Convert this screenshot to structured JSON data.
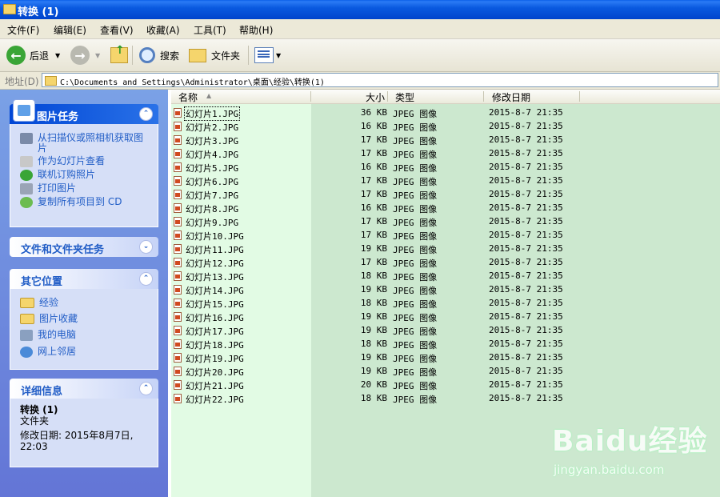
{
  "window": {
    "title": "转换 (1)"
  },
  "menu": [
    "文件(F)",
    "编辑(E)",
    "查看(V)",
    "收藏(A)",
    "工具(T)",
    "帮助(H)"
  ],
  "toolbar": {
    "back_label": "后退",
    "search_label": "搜索",
    "folders_label": "文件夹"
  },
  "address": {
    "label": "地址(D)",
    "path": "C:\\Documents and Settings\\Administrator\\桌面\\经验\\转换(1)"
  },
  "taskpane": {
    "picture_tasks": {
      "title": "图片任务",
      "items": [
        "从扫描仪或照相机获取图片",
        "作为幻灯片查看",
        "联机订购照片",
        "打印图片",
        "复制所有项目到 CD"
      ]
    },
    "file_tasks": {
      "title": "文件和文件夹任务"
    },
    "other_places": {
      "title": "其它位置",
      "items": [
        "经验",
        "图片收藏",
        "我的电脑",
        "网上邻居"
      ]
    },
    "details": {
      "title": "详细信息",
      "name": "转换 (1)",
      "type": "文件夹",
      "modified": "修改日期: 2015年8月7日, 22:03"
    }
  },
  "columns": {
    "name": "名称",
    "size": "大小",
    "type": "类型",
    "date": "修改日期"
  },
  "files": [
    {
      "name": "幻灯片1.JPG",
      "size": "36 KB",
      "type": "JPEG 图像",
      "date": "2015-8-7 21:35"
    },
    {
      "name": "幻灯片2.JPG",
      "size": "16 KB",
      "type": "JPEG 图像",
      "date": "2015-8-7 21:35"
    },
    {
      "name": "幻灯片3.JPG",
      "size": "17 KB",
      "type": "JPEG 图像",
      "date": "2015-8-7 21:35"
    },
    {
      "name": "幻灯片4.JPG",
      "size": "17 KB",
      "type": "JPEG 图像",
      "date": "2015-8-7 21:35"
    },
    {
      "name": "幻灯片5.JPG",
      "size": "16 KB",
      "type": "JPEG 图像",
      "date": "2015-8-7 21:35"
    },
    {
      "name": "幻灯片6.JPG",
      "size": "17 KB",
      "type": "JPEG 图像",
      "date": "2015-8-7 21:35"
    },
    {
      "name": "幻灯片7.JPG",
      "size": "17 KB",
      "type": "JPEG 图像",
      "date": "2015-8-7 21:35"
    },
    {
      "name": "幻灯片8.JPG",
      "size": "16 KB",
      "type": "JPEG 图像",
      "date": "2015-8-7 21:35"
    },
    {
      "name": "幻灯片9.JPG",
      "size": "17 KB",
      "type": "JPEG 图像",
      "date": "2015-8-7 21:35"
    },
    {
      "name": "幻灯片10.JPG",
      "size": "17 KB",
      "type": "JPEG 图像",
      "date": "2015-8-7 21:35"
    },
    {
      "name": "幻灯片11.JPG",
      "size": "19 KB",
      "type": "JPEG 图像",
      "date": "2015-8-7 21:35"
    },
    {
      "name": "幻灯片12.JPG",
      "size": "17 KB",
      "type": "JPEG 图像",
      "date": "2015-8-7 21:35"
    },
    {
      "name": "幻灯片13.JPG",
      "size": "18 KB",
      "type": "JPEG 图像",
      "date": "2015-8-7 21:35"
    },
    {
      "name": "幻灯片14.JPG",
      "size": "19 KB",
      "type": "JPEG 图像",
      "date": "2015-8-7 21:35"
    },
    {
      "name": "幻灯片15.JPG",
      "size": "18 KB",
      "type": "JPEG 图像",
      "date": "2015-8-7 21:35"
    },
    {
      "name": "幻灯片16.JPG",
      "size": "19 KB",
      "type": "JPEG 图像",
      "date": "2015-8-7 21:35"
    },
    {
      "name": "幻灯片17.JPG",
      "size": "19 KB",
      "type": "JPEG 图像",
      "date": "2015-8-7 21:35"
    },
    {
      "name": "幻灯片18.JPG",
      "size": "18 KB",
      "type": "JPEG 图像",
      "date": "2015-8-7 21:35"
    },
    {
      "name": "幻灯片19.JPG",
      "size": "19 KB",
      "type": "JPEG 图像",
      "date": "2015-8-7 21:35"
    },
    {
      "name": "幻灯片20.JPG",
      "size": "19 KB",
      "type": "JPEG 图像",
      "date": "2015-8-7 21:35"
    },
    {
      "name": "幻灯片21.JPG",
      "size": "20 KB",
      "type": "JPEG 图像",
      "date": "2015-8-7 21:35"
    },
    {
      "name": "幻灯片22.JPG",
      "size": "18 KB",
      "type": "JPEG 图像",
      "date": "2015-8-7 21:35"
    }
  ],
  "watermark": {
    "logo": "Baidu经验",
    "url": "jingyan.baidu.com"
  }
}
